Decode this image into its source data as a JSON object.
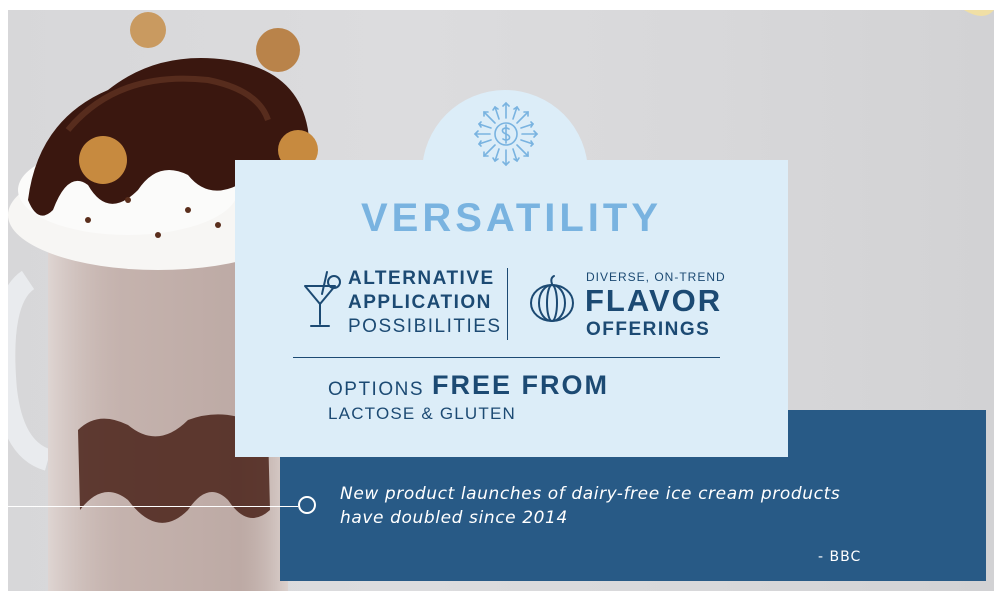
{
  "card": {
    "title": "VERSATILITY",
    "alt": {
      "line1": "ALTERNATIVE",
      "line2": "APPLICATION",
      "line3": "POSSIBILITIES"
    },
    "flavor": {
      "top": "DIVERSE, ON-TREND",
      "big": "FLAVOR",
      "bottom": "OFFERINGS"
    },
    "free_from": {
      "prefix": "OPTIONS",
      "bold": "FREE FROM",
      "line2": "LACTOSE & GLUTEN"
    }
  },
  "quote": {
    "line1": "New product launches of dairy-free ice cream products",
    "line2": "have doubled since 2014",
    "source": "- BBC"
  },
  "icons": {
    "top": "dollar-burst-icon",
    "left": "cocktail-glass-icon",
    "right": "pumpkin-icon"
  },
  "colors": {
    "title": "#79b3e0",
    "text": "#1c4a73",
    "card": "#dcedf8",
    "panel": "#285a86"
  }
}
